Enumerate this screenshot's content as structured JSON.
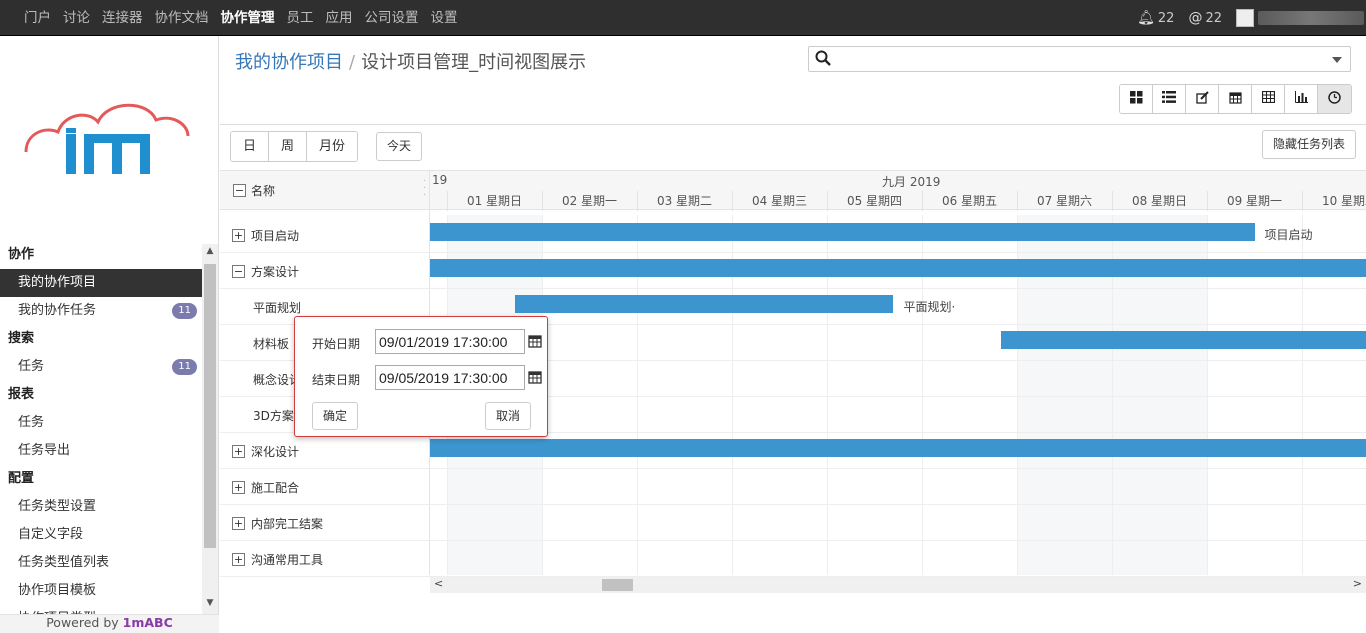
{
  "topnav": [
    "门户",
    "讨论",
    "连接器",
    "协作文档",
    "协作管理",
    "员工",
    "应用",
    "公司设置",
    "设置"
  ],
  "topbar": {
    "notifications": "22",
    "mentions": "22"
  },
  "sidebar": {
    "sections": [
      {
        "title": "协作",
        "items": [
          {
            "label": "我的协作项目",
            "badge": ""
          },
          {
            "label": "我的协作任务",
            "badge": "11"
          }
        ]
      },
      {
        "title": "搜索",
        "items": [
          {
            "label": "任务",
            "badge": "11"
          }
        ]
      },
      {
        "title": "报表",
        "items": [
          {
            "label": "任务",
            "badge": ""
          },
          {
            "label": "任务导出",
            "badge": ""
          }
        ]
      },
      {
        "title": "配置",
        "items": [
          {
            "label": "任务类型设置",
            "badge": ""
          },
          {
            "label": "自定义字段",
            "badge": ""
          },
          {
            "label": "任务类型值列表",
            "badge": ""
          },
          {
            "label": "协作项目模板",
            "badge": ""
          },
          {
            "label": "协作项目类型",
            "badge": ""
          }
        ]
      }
    ],
    "powered_prefix": "Powered by ",
    "powered_brand": "1mABC"
  },
  "breadcrumb": {
    "parent": "我的协作项目",
    "current": "设计项目管理_时间视图展示"
  },
  "view_icons": [
    "kanban-icon",
    "list-icon",
    "edit-icon",
    "calendar-icon",
    "table-icon",
    "chart-icon",
    "clock-icon"
  ],
  "gantt": {
    "scale_buttons": [
      "日",
      "周",
      "月份"
    ],
    "today": "今天",
    "hide_tasks": "隐藏任务列表",
    "name_header": "名称",
    "prev_month_stub": "19",
    "month": "九月 2019",
    "days": [
      "01 星期日",
      "02 星期一",
      "03 星期二",
      "04 星期三",
      "05 星期四",
      "06 星期五",
      "07 星期六",
      "08 星期日",
      "09 星期一",
      "10 星期二"
    ],
    "rows": [
      {
        "name": "项目启动",
        "toggle": "+",
        "level": 0,
        "bar_label": "项目启动"
      },
      {
        "name": "方案设计",
        "toggle": "−",
        "level": 0,
        "bar_label": ""
      },
      {
        "name": "平面规划",
        "toggle": "",
        "level": 1,
        "bar_label": "平面规划·"
      },
      {
        "name": "材料板",
        "toggle": "",
        "level": 1,
        "bar_label": ""
      },
      {
        "name": "概念设计",
        "toggle": "",
        "level": 1,
        "bar_label": ""
      },
      {
        "name": "3D方案",
        "toggle": "",
        "level": 1,
        "bar_label": ""
      },
      {
        "name": "深化设计",
        "toggle": "+",
        "level": 0,
        "bar_label": ""
      },
      {
        "name": "施工配合",
        "toggle": "+",
        "level": 0,
        "bar_label": ""
      },
      {
        "name": "内部完工结案",
        "toggle": "+",
        "level": 0,
        "bar_label": ""
      },
      {
        "name": "沟通常用工具",
        "toggle": "+",
        "level": 0,
        "bar_label": ""
      }
    ]
  },
  "popup": {
    "start_label": "开始日期",
    "start_value": "09/01/2019 17:30:00",
    "end_label": "结束日期",
    "end_value": "09/05/2019 17:30:00",
    "ok": "确定",
    "cancel": "取消"
  },
  "colors": {
    "bar": "#3d95cf",
    "topbar": "#2f2f2f",
    "link": "#3677b7",
    "badge": "#7c7bad",
    "popup_border": "#d23c3c"
  }
}
